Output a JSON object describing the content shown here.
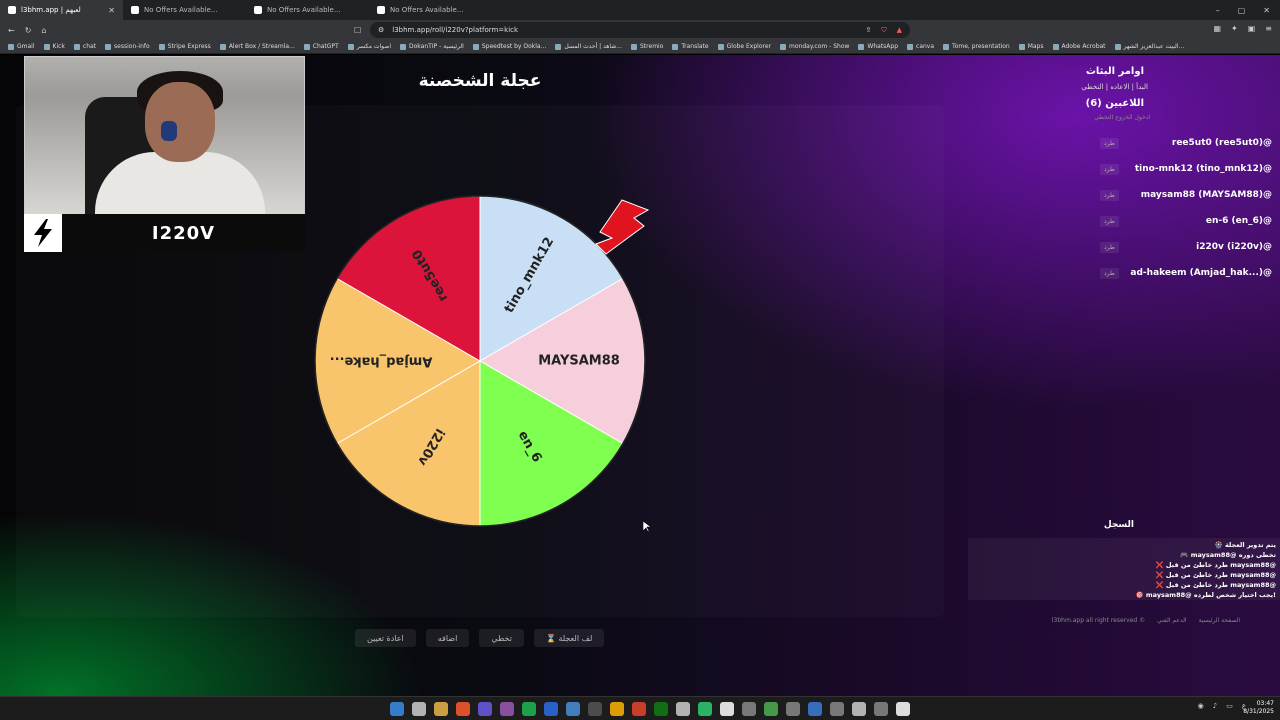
{
  "browser": {
    "tabs": [
      {
        "label": "l3bhm.app | لعبهم",
        "active": true
      },
      {
        "label": "No Offers Available...",
        "active": false
      },
      {
        "label": "No Offers Available...",
        "active": false
      },
      {
        "label": "No Offers Available...",
        "active": false
      }
    ],
    "url": "l3bhm.app/roll/i220v?platform=kick",
    "bookmarks": [
      "Gmail",
      "Kick",
      "chat",
      "session-info",
      "Stripe Express",
      "Alert Box / Streamla...",
      "ChatGPT",
      "اصوات مكسر",
      "DokanTIP - الرئيسية",
      "Speedtest by Ookla...",
      "شاهد | أحدث المسل...",
      "Stremio",
      "Translate",
      "Globe Explorer",
      "monday.com - Show",
      "WhatsApp",
      "canva",
      "Tome, presentation",
      "Maps",
      "Adobe Acrobat",
      "البيت عبدالعزيز الشهر..."
    ]
  },
  "main": {
    "title": "عجلة الشخصنة",
    "buttons": {
      "spin": "⌛ لف العجلة",
      "skip": "تخطي",
      "add": "اضافه",
      "reset": "اعادة تعيين"
    }
  },
  "wheel": {
    "segments": [
      {
        "label": "tino_mnk12",
        "color": "#c9dff5"
      },
      {
        "label": "MAYSAM88",
        "color": "#f7cfdc"
      },
      {
        "label": "en_6",
        "color": "#7fff4f"
      },
      {
        "label": "i220v",
        "color": "#f8c46c"
      },
      {
        "label": "Amjad_hake...",
        "color": "#f8c46c"
      },
      {
        "label": "ree5ut0",
        "color": "#dc143c"
      }
    ]
  },
  "streamer": {
    "name": "I220V"
  },
  "sidebar": {
    "commands_title": "اوامر البثاث",
    "commands": "البدأ | الاعاده | التخطي",
    "players_title": "اللاعبين (6)",
    "join_links": "ادخول  الخروج  التخطي",
    "kick_label": "طرد",
    "players": [
      "ree5ut0 (ree5ut0)@",
      "tino-mnk12 (tino_mnk12)@",
      "maysam88 (MAYSAM88)@",
      "en-6 (en_6)@",
      "i220v (i220v)@",
      "ad-hakeem (Amjad_hak...)@"
    ],
    "log_title": "السجل",
    "log": [
      "🎡 يتم تدوير العجلة",
      "🎮 maysam88@ تخطى دوره",
      "❌ طرد خاطئ من قبل maysam88@",
      "❌ طرد خاطئ من قبل maysam88@",
      "❌ طرد خاطئ من قبل maysam88@",
      "🎯 maysam88@ يجب اختيار شخص لطرده!"
    ],
    "footer": [
      "l3bhm.app all right reserved ©",
      "الدعم الفني",
      "الصفحة الرئيسية"
    ]
  },
  "taskbar": {
    "time": "03:47",
    "date": "8/31/2025",
    "tray_lang": "ع"
  }
}
